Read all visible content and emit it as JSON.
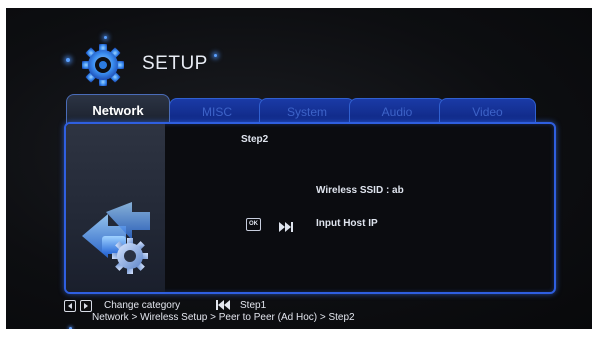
{
  "header": {
    "title": "SETUP",
    "icon": "gear-icon"
  },
  "tabs": [
    {
      "label": "Network",
      "active": true
    },
    {
      "label": "MISC",
      "active": false
    },
    {
      "label": "System",
      "active": false
    },
    {
      "label": "Audio",
      "active": false
    },
    {
      "label": "Video",
      "active": false
    }
  ],
  "panel": {
    "step_title": "Step2",
    "ssid_text": "Wireless SSID : ab",
    "ok_label": "OK",
    "host_label": "Input Host IP"
  },
  "footer": {
    "change_category": "Change category",
    "step_back": "Step1",
    "breadcrumb": "Network > Wireless Setup > Peer to Peer (Ad Hoc) > Step2"
  },
  "colors": {
    "accent": "#2f5fe0",
    "tab_inactive": "#1a3aa6",
    "background": "#0d0e11",
    "text": "#dfe4ee"
  }
}
